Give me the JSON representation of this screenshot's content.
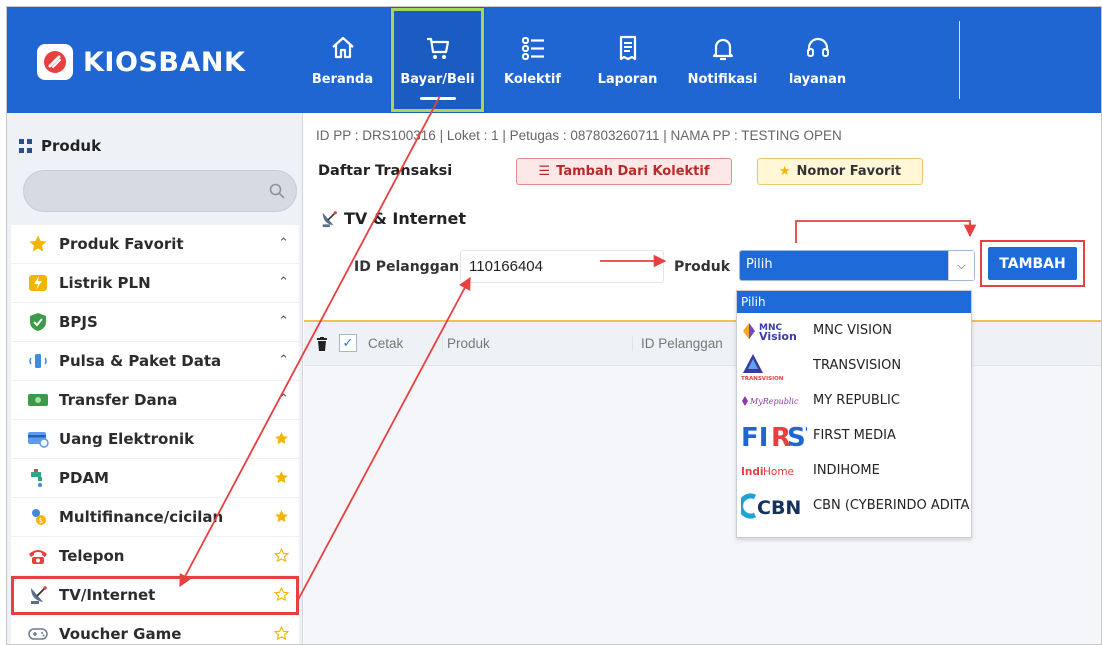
{
  "app": {
    "logo_text": "KIOSBANK"
  },
  "nav": {
    "items": [
      {
        "label": "Beranda",
        "icon": "home-icon"
      },
      {
        "label": "Bayar/Beli",
        "icon": "cart-icon"
      },
      {
        "label": "Kolektif",
        "icon": "list-icon"
      },
      {
        "label": "Laporan",
        "icon": "receipt-icon"
      },
      {
        "label": "Notifikasi",
        "icon": "bell-icon"
      },
      {
        "label": "layanan",
        "icon": "headset-icon"
      }
    ],
    "active": "Bayar/Beli"
  },
  "sidebar": {
    "title": "Produk",
    "search_placeholder": "",
    "items": [
      {
        "label": "Produk Favorit",
        "icon": "star-icon",
        "right": "caret-up"
      },
      {
        "label": "Listrik PLN",
        "icon": "lightning-icon",
        "right": "caret-up"
      },
      {
        "label": "BPJS",
        "icon": "shield-icon",
        "right": "caret-up"
      },
      {
        "label": "Pulsa & Paket Data",
        "icon": "phone-signal-icon",
        "right": "caret-up"
      },
      {
        "label": "Transfer Dana",
        "icon": "money-icon",
        "right": "caret-up"
      },
      {
        "label": "Uang Elektronik",
        "icon": "card-icon",
        "right": "star-filled"
      },
      {
        "label": "PDAM",
        "icon": "faucet-icon",
        "right": "star-filled"
      },
      {
        "label": "Multifinance/cicilan",
        "icon": "finance-icon",
        "right": "star-filled"
      },
      {
        "label": "Telepon",
        "icon": "telephone-icon",
        "right": "star-outline"
      },
      {
        "label": "TV/Internet",
        "icon": "satellite-icon",
        "right": "star-outline"
      },
      {
        "label": "Voucher Game",
        "icon": "gamepad-icon",
        "right": "star-outline"
      }
    ],
    "selected": "TV/Internet"
  },
  "main": {
    "info_line": "ID PP : DRS100316 | Loket : 1 | Petugas : 087803260711 | NAMA PP : TESTING OPEN",
    "daftar_label": "Daftar Transaksi",
    "btn_kolektif": "Tambah Dari Kolektif",
    "btn_favorit": "Nomor Favorit",
    "section_title": "TV & Internet",
    "id_label": "ID Pelanggan",
    "id_value": "110166404",
    "produk_label": "Produk",
    "produk_selected": "Pilih",
    "tambah_label": "TAMBAH",
    "dropdown": {
      "header": "Pilih",
      "options": [
        {
          "label": "MNC VISION",
          "logo": "MNC VISION"
        },
        {
          "label": "TRANSVISION",
          "logo": "TRANSVISION"
        },
        {
          "label": "MY REPUBLIC",
          "logo": "MyRepublic"
        },
        {
          "label": "FIRST MEDIA",
          "logo": "FIRST"
        },
        {
          "label": "INDIHOME",
          "logo": "IndiHome"
        },
        {
          "label": "CBN (CYBERINDO ADITA",
          "logo": "CBN"
        }
      ]
    },
    "grid_headers": {
      "cetak": "Cetak",
      "produk": "Produk",
      "id_pelanggan": "ID Pelanggan"
    }
  },
  "colors": {
    "primary": "#1f66d3",
    "accent_green": "#a9d65a",
    "annotation_red": "#e8403f",
    "star_gold": "#f5b400"
  }
}
